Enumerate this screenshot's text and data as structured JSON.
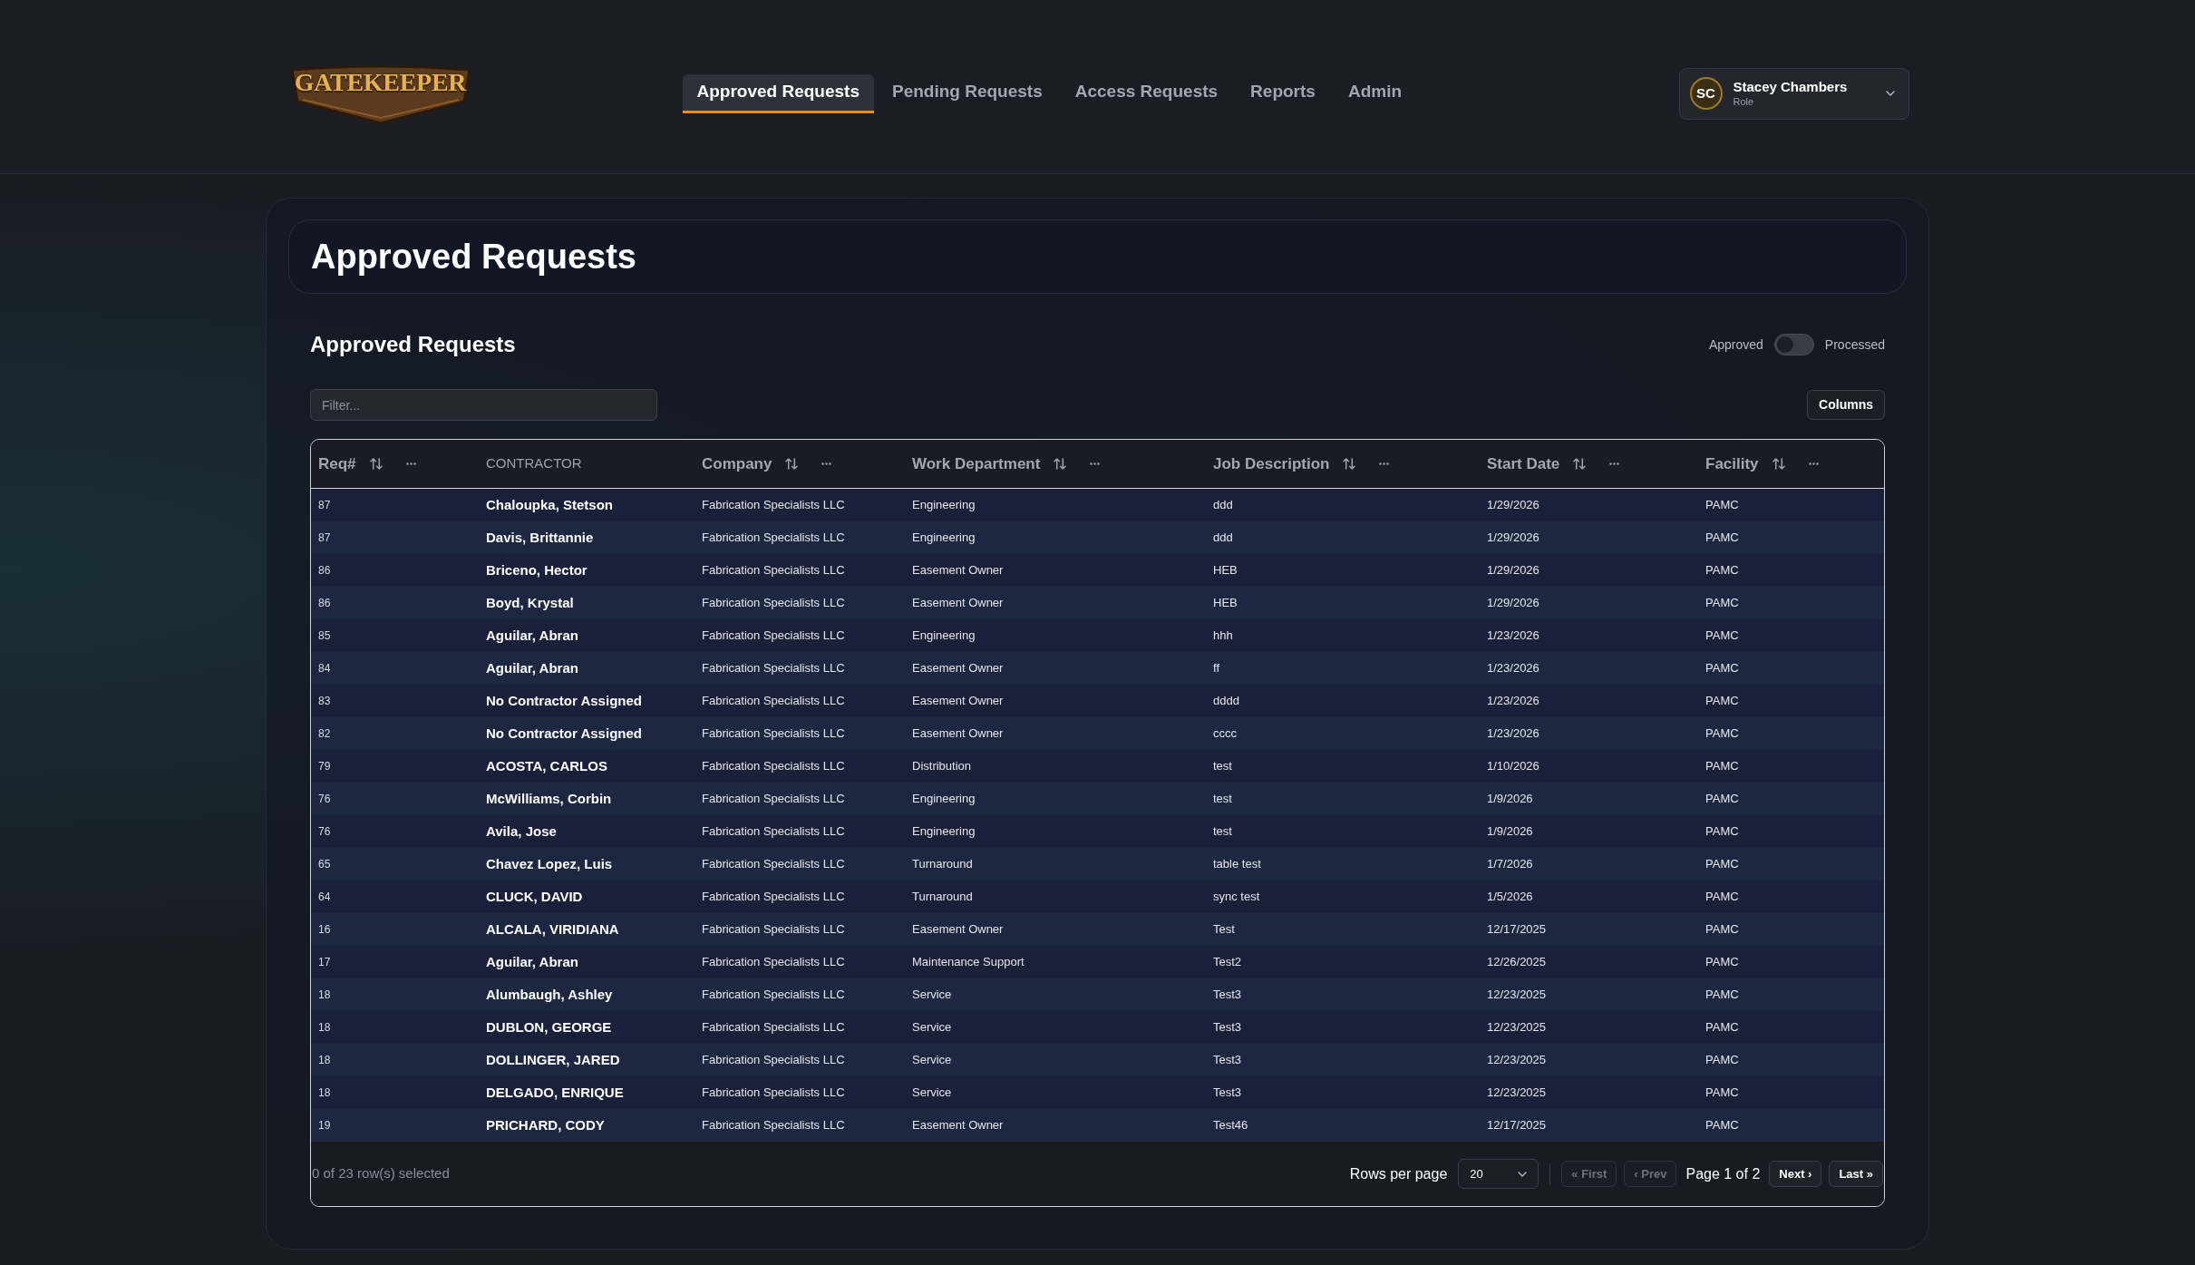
{
  "header": {
    "logo": "GATEKEEPER",
    "nav": [
      {
        "label": "Approved Requests",
        "selected": true
      },
      {
        "label": "Pending Requests",
        "selected": false
      },
      {
        "label": "Access Requests",
        "selected": false
      },
      {
        "label": "Reports",
        "selected": false
      },
      {
        "label": "Admin",
        "selected": false
      }
    ],
    "user": {
      "initials": "SC",
      "name": "Stacey Chambers",
      "role": "Role"
    }
  },
  "page_title": "Approved Requests",
  "section": {
    "title": "Approved Requests",
    "toggle": {
      "left_label": "Approved",
      "right_label": "Processed",
      "on": false
    }
  },
  "filter": {
    "placeholder": "Filter..."
  },
  "columns_button": "Columns",
  "table": {
    "columns": [
      {
        "label": "Req#",
        "kind": "id",
        "sortable": true,
        "menu": true
      },
      {
        "label": "CONTRACTOR",
        "kind": "name",
        "sortable": false,
        "menu": false
      },
      {
        "label": "Company",
        "kind": "text",
        "sortable": true,
        "menu": true
      },
      {
        "label": "Work Department",
        "kind": "text",
        "sortable": true,
        "menu": true
      },
      {
        "label": "Job Description",
        "kind": "text",
        "sortable": true,
        "menu": true
      },
      {
        "label": "Start Date",
        "kind": "text",
        "sortable": true,
        "menu": true
      },
      {
        "label": "Facility",
        "kind": "text",
        "sortable": true,
        "menu": true
      }
    ],
    "rows": [
      [
        "87",
        "Chaloupka, Stetson",
        "Fabrication Specialists LLC",
        "Engineering",
        "ddd",
        "1/29/2026",
        "PAMC"
      ],
      [
        "87",
        "Davis, Brittannie",
        "Fabrication Specialists LLC",
        "Engineering",
        "ddd",
        "1/29/2026",
        "PAMC"
      ],
      [
        "86",
        "Briceno, Hector",
        "Fabrication Specialists LLC",
        "Easement Owner",
        "HEB",
        "1/29/2026",
        "PAMC"
      ],
      [
        "86",
        "Boyd, Krystal",
        "Fabrication Specialists LLC",
        "Easement Owner",
        "HEB",
        "1/29/2026",
        "PAMC"
      ],
      [
        "85",
        "Aguilar, Abran",
        "Fabrication Specialists LLC",
        "Engineering",
        "hhh",
        "1/23/2026",
        "PAMC"
      ],
      [
        "84",
        "Aguilar, Abran",
        "Fabrication Specialists LLC",
        "Easement Owner",
        "ff",
        "1/23/2026",
        "PAMC"
      ],
      [
        "83",
        "No Contractor Assigned",
        "Fabrication Specialists LLC",
        "Easement Owner",
        "dddd",
        "1/23/2026",
        "PAMC"
      ],
      [
        "82",
        "No Contractor Assigned",
        "Fabrication Specialists LLC",
        "Easement Owner",
        "cccc",
        "1/23/2026",
        "PAMC"
      ],
      [
        "79",
        "ACOSTA, CARLOS",
        "Fabrication Specialists LLC",
        "Distribution",
        "test",
        "1/10/2026",
        "PAMC"
      ],
      [
        "76",
        "McWilliams, Corbin",
        "Fabrication Specialists LLC",
        "Engineering",
        "test",
        "1/9/2026",
        "PAMC"
      ],
      [
        "76",
        "Avila, Jose",
        "Fabrication Specialists LLC",
        "Engineering",
        "test",
        "1/9/2026",
        "PAMC"
      ],
      [
        "65",
        "Chavez Lopez, Luis",
        "Fabrication Specialists LLC",
        "Turnaround",
        "table test",
        "1/7/2026",
        "PAMC"
      ],
      [
        "64",
        "CLUCK, DAVID",
        "Fabrication Specialists LLC",
        "Turnaround",
        "sync test",
        "1/5/2026",
        "PAMC"
      ],
      [
        "16",
        "ALCALA, VIRIDIANA",
        "Fabrication Specialists LLC",
        "Easement Owner",
        "Test",
        "12/17/2025",
        "PAMC"
      ],
      [
        "17",
        "Aguilar, Abran",
        "Fabrication Specialists LLC",
        "Maintenance Support",
        "Test2",
        "12/26/2025",
        "PAMC"
      ],
      [
        "18",
        "Alumbaugh, Ashley",
        "Fabrication Specialists LLC",
        "Service",
        "Test3",
        "12/23/2025",
        "PAMC"
      ],
      [
        "18",
        "DUBLON, GEORGE",
        "Fabrication Specialists LLC",
        "Service",
        "Test3",
        "12/23/2025",
        "PAMC"
      ],
      [
        "18",
        "DOLLINGER, JARED",
        "Fabrication Specialists LLC",
        "Service",
        "Test3",
        "12/23/2025",
        "PAMC"
      ],
      [
        "18",
        "DELGADO, ENRIQUE",
        "Fabrication Specialists LLC",
        "Service",
        "Test3",
        "12/23/2025",
        "PAMC"
      ],
      [
        "19",
        "PRICHARD, CODY",
        "Fabrication Specialists LLC",
        "Easement Owner",
        "Test46",
        "12/17/2025",
        "PAMC"
      ]
    ]
  },
  "footer": {
    "selection": "0 of 23 row(s) selected",
    "rows_per_page_label": "Rows per page",
    "rows_per_page": "20",
    "pagination": [
      {
        "kind": "button",
        "label": "« First",
        "disabled": true
      },
      {
        "kind": "button",
        "label": "‹ Prev",
        "disabled": true
      },
      {
        "kind": "text",
        "label": "Page 1 of 2"
      },
      {
        "kind": "button",
        "label": "Next ›",
        "disabled": false
      },
      {
        "kind": "button",
        "label": "Last »",
        "disabled": false
      }
    ]
  }
}
